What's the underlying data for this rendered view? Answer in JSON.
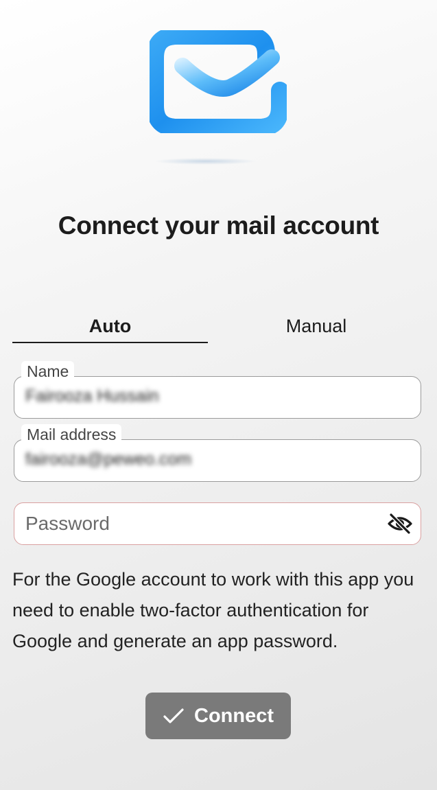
{
  "header": {
    "logo_icon": "mail-envelope-icon",
    "title": "Connect your mail account"
  },
  "tabs": [
    {
      "label": "Auto",
      "active": true
    },
    {
      "label": "Manual",
      "active": false
    }
  ],
  "form": {
    "name": {
      "label": "Name",
      "value": "Fairooza Hussain"
    },
    "mail": {
      "label": "Mail address",
      "value": "fairooza@peweo.com"
    },
    "password": {
      "placeholder": "Password",
      "value": "",
      "visibility_icon": "eye-off-icon"
    }
  },
  "help_text": "For the Google account to work with this app you need to enable two-factor authentication for Google and generate an app password.",
  "connect_button": {
    "label": "Connect",
    "icon": "check-icon"
  },
  "colors": {
    "logo_blue": "#1e9bf0",
    "button_bg": "#7a7a7a",
    "password_border": "#d9a0a0"
  }
}
